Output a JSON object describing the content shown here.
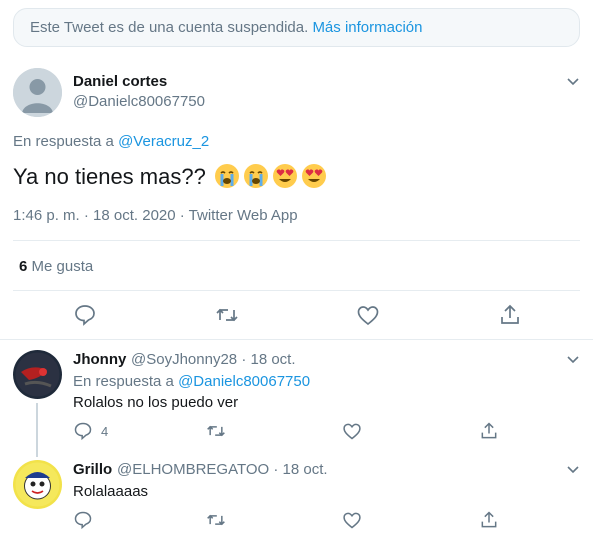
{
  "notice": {
    "text": "Este Tweet es de una cuenta suspendida.",
    "link": "Más información"
  },
  "main_tweet": {
    "name": "Daniel cortes",
    "handle": "@Danielc80067750",
    "reply_prefix": "En respuesta a",
    "reply_to": "@Veracruz_2",
    "text": "Ya no tienes mas??",
    "emojis": [
      "crying-face-emoji",
      "crying-face-emoji",
      "heart-eyes-emoji",
      "heart-eyes-emoji"
    ],
    "timestamp": "1:46 p. m. · 18 oct. 2020 · Twitter Web App",
    "likes_count": "6",
    "likes_label": "Me gusta"
  },
  "actions": [
    "reply-icon",
    "retweet-icon",
    "like-icon",
    "share-icon"
  ],
  "replies": [
    {
      "name": "Jhonny",
      "handle": "@SoyJhonny28",
      "date": "· 18 oct.",
      "reply_prefix": "En respuesta a",
      "reply_to": "@Danielc80067750",
      "text": "Rolalos no los puedo ver",
      "reply_count": "4"
    },
    {
      "name": "Grillo",
      "handle": "@ELHOMBREGATOO",
      "date": "· 18 oct.",
      "text": "Rolalaaaas"
    }
  ],
  "colors": {
    "link": "#1b95e0",
    "secondary_text": "#657786",
    "primary_text": "#14171a",
    "divider": "#e6ecf0"
  }
}
